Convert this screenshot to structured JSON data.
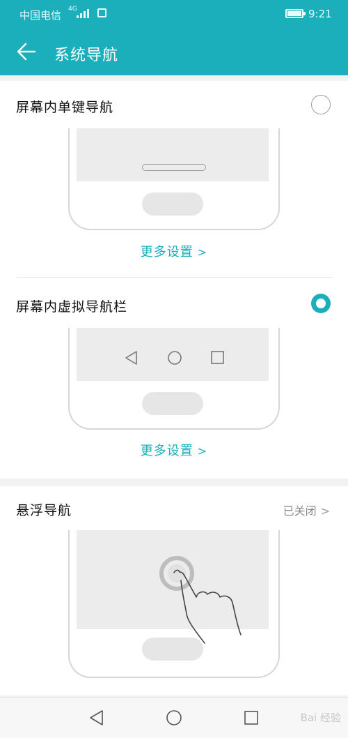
{
  "status_bar": {
    "carrier": "中国电信",
    "network": "4G",
    "time": "9:21",
    "icons": [
      "signal-icon",
      "notification-icon",
      "battery-icon"
    ]
  },
  "header": {
    "title": "系统导航",
    "back_icon": "back-arrow-icon",
    "color": "#1aafbb"
  },
  "options": [
    {
      "label": "屏幕内单键导航",
      "selected": false,
      "more_label": "更多设置"
    },
    {
      "label": "屏幕内虚拟导航栏",
      "selected": true,
      "more_label": "更多设置"
    }
  ],
  "floating_nav": {
    "label": "悬浮导航",
    "status": "已关闭"
  },
  "bottom_nav": {
    "icons": [
      "back-triangle-icon",
      "home-circle-icon",
      "recents-square-icon"
    ]
  },
  "watermark": "Bai 经验"
}
